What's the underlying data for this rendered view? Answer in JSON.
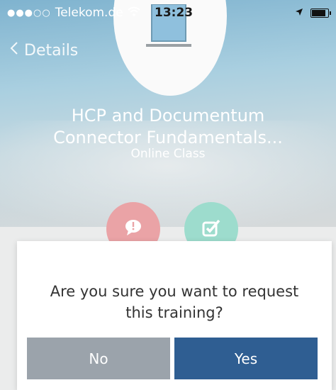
{
  "status_bar": {
    "signal": "●●●○○",
    "carrier": "Telekom.de",
    "time": "13:23"
  },
  "nav": {
    "back_label": "Details"
  },
  "course": {
    "title_line1": "HCP and Documentum",
    "title_line2": "Connector Fundamentals...",
    "type": "Online Class"
  },
  "icons": {
    "course_image": "laptop-icon",
    "comment": "comment-alert-icon",
    "check": "checkbox-icon"
  },
  "colors": {
    "no_button": "#9ba3ab",
    "yes_button": "#2f5e92",
    "comment_action": "#eaa3a6",
    "check_action": "#9ddccd"
  },
  "dialog": {
    "message_line1": "Are you sure you want to request",
    "message_line2": "this training?",
    "no_label": "No",
    "yes_label": "Yes"
  }
}
